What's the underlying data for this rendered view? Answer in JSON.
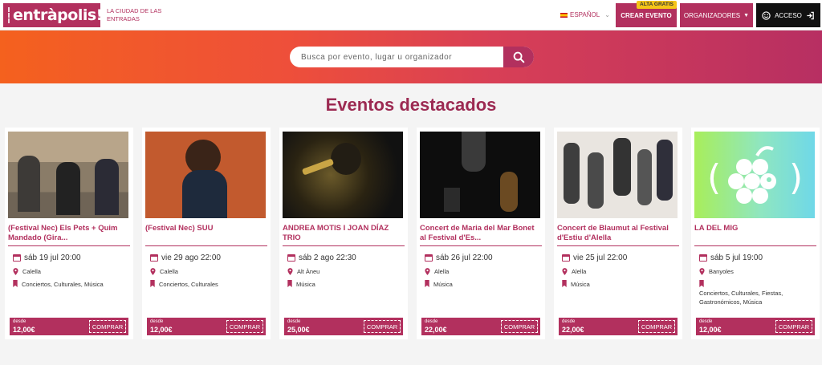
{
  "header": {
    "logo_text": "entràpolis!",
    "tagline": "LA CIUDAD DE LAS ENTRADAS",
    "language": "ESPAÑOL",
    "alta_badge": "ALTA GRATIS",
    "crear_evento": "CREAR EVENTO",
    "organizadores": "ORGANIZADORES",
    "acceso": "ACCESO"
  },
  "search": {
    "placeholder": "Busca por evento, lugar u organizador"
  },
  "section_title": "Eventos destacados",
  "events": [
    {
      "title": "(Festival Nec) Els Pets + Quim Mandado (Gira...",
      "date": "sáb 19 jul 20:00",
      "place": "Calella",
      "categories": "Conciertos, Culturales, Música",
      "desde": "desde",
      "price": "12,00€",
      "buy": "COMPRAR"
    },
    {
      "title": "(Festival Nec) SUU",
      "date": "vie 29 ago 22:00",
      "place": "Calella",
      "categories": "Conciertos, Culturales",
      "desde": "desde",
      "price": "12,00€",
      "buy": "COMPRAR"
    },
    {
      "title": "ANDREA MOTIS I JOAN DÍAZ TRIO",
      "date": "sáb 2 ago 22:30",
      "place": "Alt Àneu",
      "categories": "Música",
      "desde": "desde",
      "price": "25,00€",
      "buy": "COMPRAR"
    },
    {
      "title": "Concert de Maria del Mar Bonet al Festival d'Es...",
      "date": "sáb 26 jul 22:00",
      "place": "Alella",
      "categories": "Música",
      "desde": "desde",
      "price": "22,00€",
      "buy": "COMPRAR"
    },
    {
      "title": "Concert de Blaumut al Festival d'Estiu d'Alella",
      "date": "vie 25 jul 22:00",
      "place": "Alella",
      "categories": "Música",
      "desde": "desde",
      "price": "22,00€",
      "buy": "COMPRAR"
    },
    {
      "title": "LA DEL MIG",
      "date": "sáb 5 jul 19:00",
      "place": "Banyoles",
      "categories": "Conciertos, Culturales, Fiestas, Gastronómicos, Música",
      "desde": "desde",
      "price": "12,00€",
      "buy": "COMPRAR"
    }
  ],
  "colors": {
    "brand": "#b2305e",
    "hero_start": "#f4611e",
    "hero_end": "#b72f62"
  },
  "icons": [
    "search-icon",
    "smiley-icon",
    "login-icon",
    "calendar-icon",
    "location-pin-icon",
    "bookmark-icon",
    "chevron-down-icon",
    "caret-down-icon"
  ]
}
